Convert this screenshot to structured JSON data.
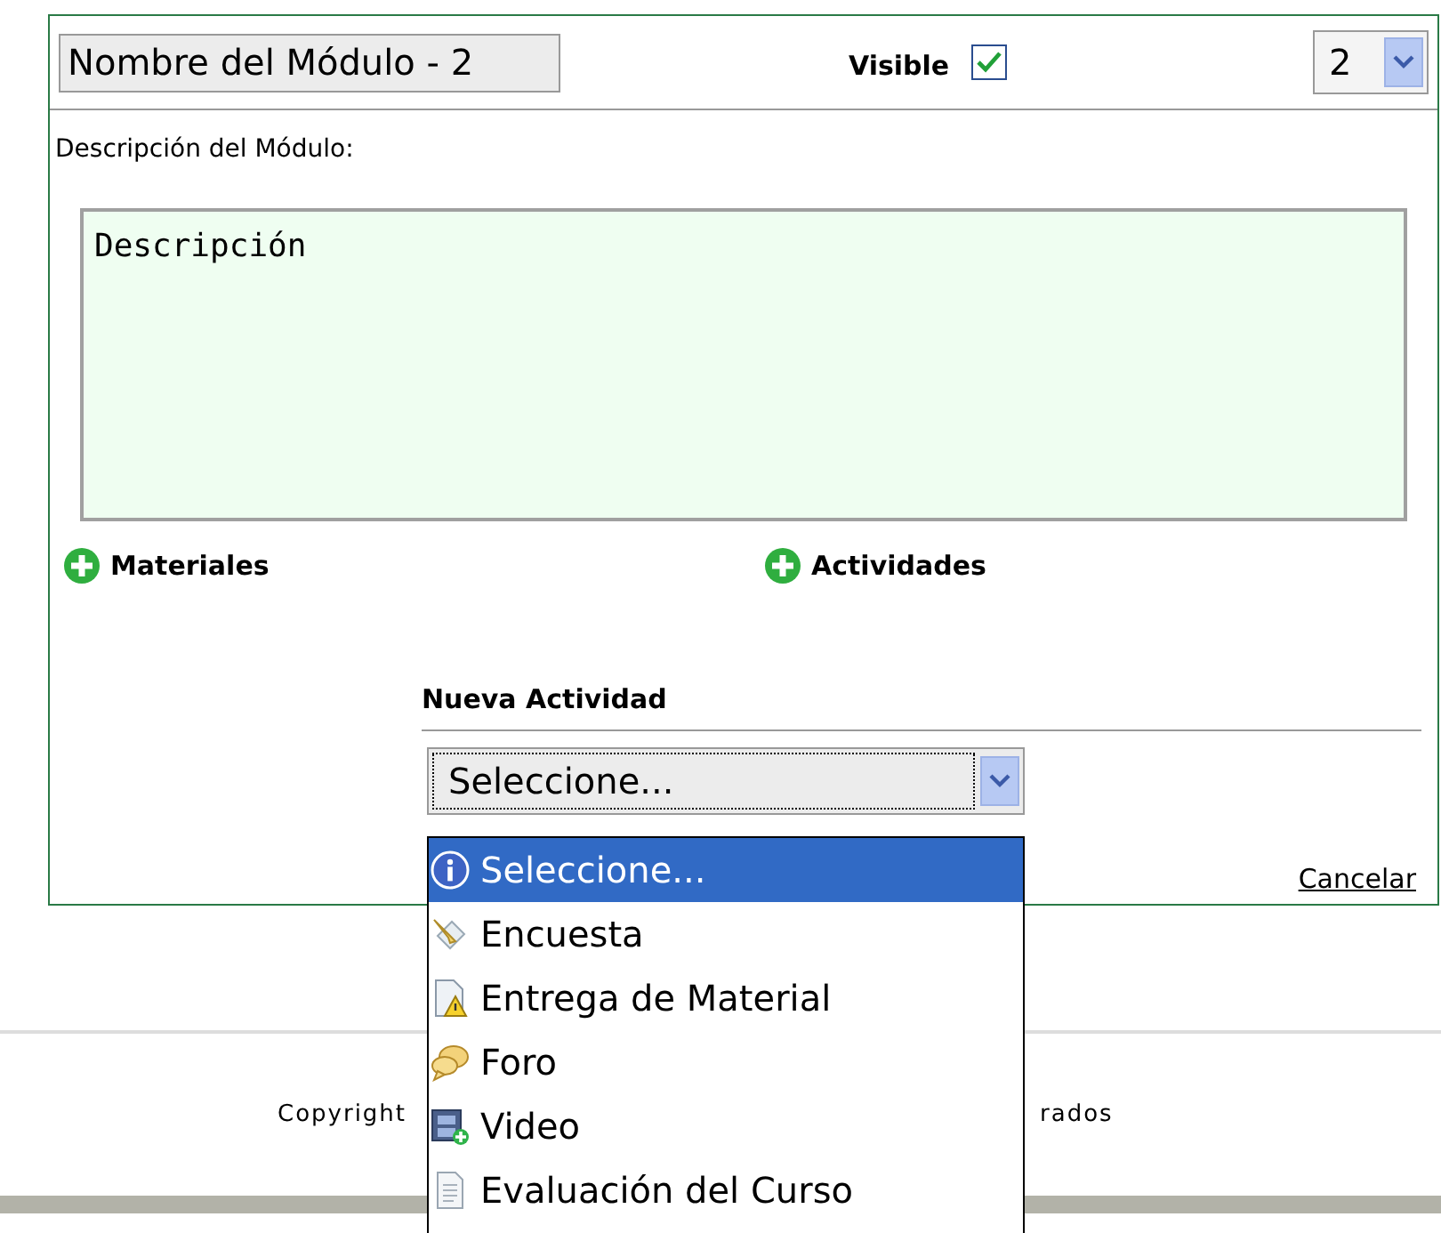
{
  "module": {
    "name": "Nombre del Módulo - 2",
    "visible_label": "Visible",
    "visible": true,
    "order": "2"
  },
  "description": {
    "label": "Descripción del Módulo:",
    "value": "Descripción"
  },
  "add_links": [
    {
      "label": "Materiales"
    },
    {
      "label": "Actividades"
    }
  ],
  "new_activity": {
    "heading": "Nueva Actividad",
    "value": "Seleccione...",
    "cancel": "Cancelar",
    "options": [
      {
        "kind": "info",
        "label": "Seleccione...",
        "selected": true
      },
      {
        "kind": "survey",
        "label": "Encuesta",
        "selected": false
      },
      {
        "kind": "delivery",
        "label": "Entrega de Material",
        "selected": false
      },
      {
        "kind": "forum",
        "label": "Foro",
        "selected": false
      },
      {
        "kind": "video",
        "label": "Video",
        "selected": false
      },
      {
        "kind": "doc",
        "label": "Evaluación del Curso",
        "selected": false
      }
    ]
  },
  "footer": {
    "text_left": "Copyright",
    "text_right": "rados"
  }
}
